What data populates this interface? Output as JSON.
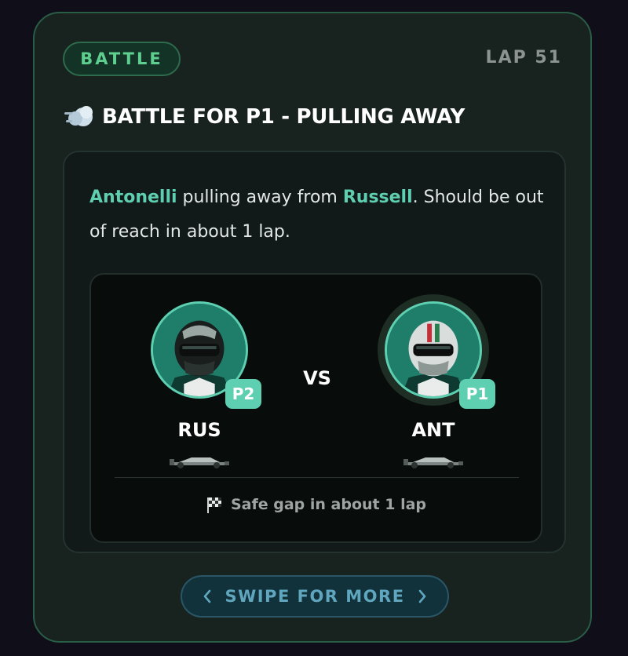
{
  "card": {
    "badge": "BATTLE",
    "lap": "LAP 51",
    "title": "BATTLE FOR P1 - PULLING AWAY",
    "description": {
      "leader": "Antonelli",
      "middle": " pulling away from ",
      "chaser": "Russell",
      "rest": ". Should be out of reach in about 1 lap."
    },
    "battle": {
      "drivers": [
        {
          "code": "RUS",
          "position": "P2"
        },
        {
          "code": "ANT",
          "position": "P1"
        }
      ],
      "vs": "VS",
      "gap_text": "Safe gap in about 1 lap"
    },
    "swipe_label": "SWIPE FOR MORE"
  },
  "colors": {
    "accent_teal": "#5ecfb0",
    "badge_green": "#5ecf8f",
    "swipe_blue": "#5fa6be"
  },
  "icons": {
    "title": "dash-puff-icon",
    "gap": "chequered-flag-icon",
    "swipe_left": "chevron-left-icon",
    "swipe_right": "chevron-right-icon"
  }
}
